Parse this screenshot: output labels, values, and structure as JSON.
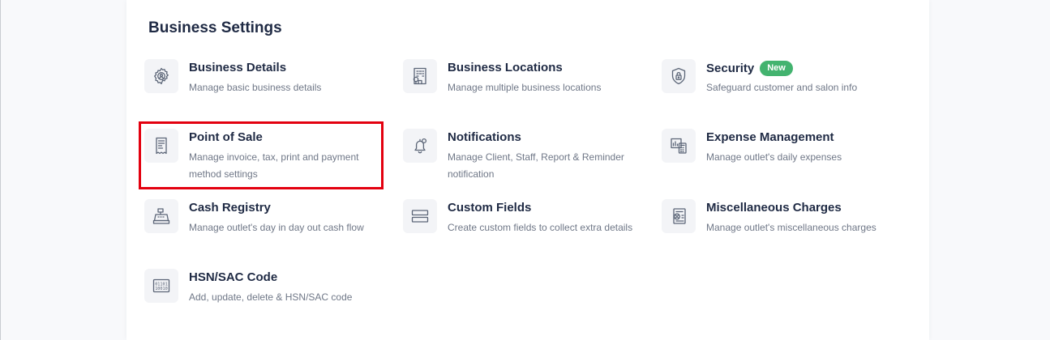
{
  "section_title": "Business Settings",
  "highlight_color": "#e3000f",
  "badge_color": "#43b36f",
  "items": [
    {
      "title": "Business Details",
      "desc": "Manage basic business details",
      "icon": "gear-person-icon"
    },
    {
      "title": "Business Locations",
      "desc": "Manage multiple business locations",
      "icon": "building-pin-icon"
    },
    {
      "title": "Security",
      "badge": "New",
      "desc": "Safeguard customer and salon info",
      "icon": "shield-lock-icon"
    },
    {
      "title": "Point of Sale",
      "desc": "Manage invoice, tax, print and payment method settings",
      "icon": "receipt-icon",
      "highlighted": true
    },
    {
      "title": "Notifications",
      "desc": "Manage Client, Staff, Report & Reminder notification",
      "icon": "bell-icon"
    },
    {
      "title": "Expense Management",
      "desc": "Manage outlet's daily expenses",
      "icon": "calculator-chart-icon"
    },
    {
      "title": "Cash Registry",
      "desc": "Manage outlet's day in day out cash flow",
      "icon": "cash-register-icon"
    },
    {
      "title": "Custom Fields",
      "desc": "Create custom fields to collect extra details",
      "icon": "form-fields-icon"
    },
    {
      "title": "Miscellaneous Charges",
      "desc": "Manage outlet's miscellaneous charges",
      "icon": "charges-document-icon"
    },
    {
      "title": "HSN/SAC Code",
      "desc": "Add, update, delete & HSN/SAC code",
      "icon": "binary-code-icon"
    }
  ]
}
